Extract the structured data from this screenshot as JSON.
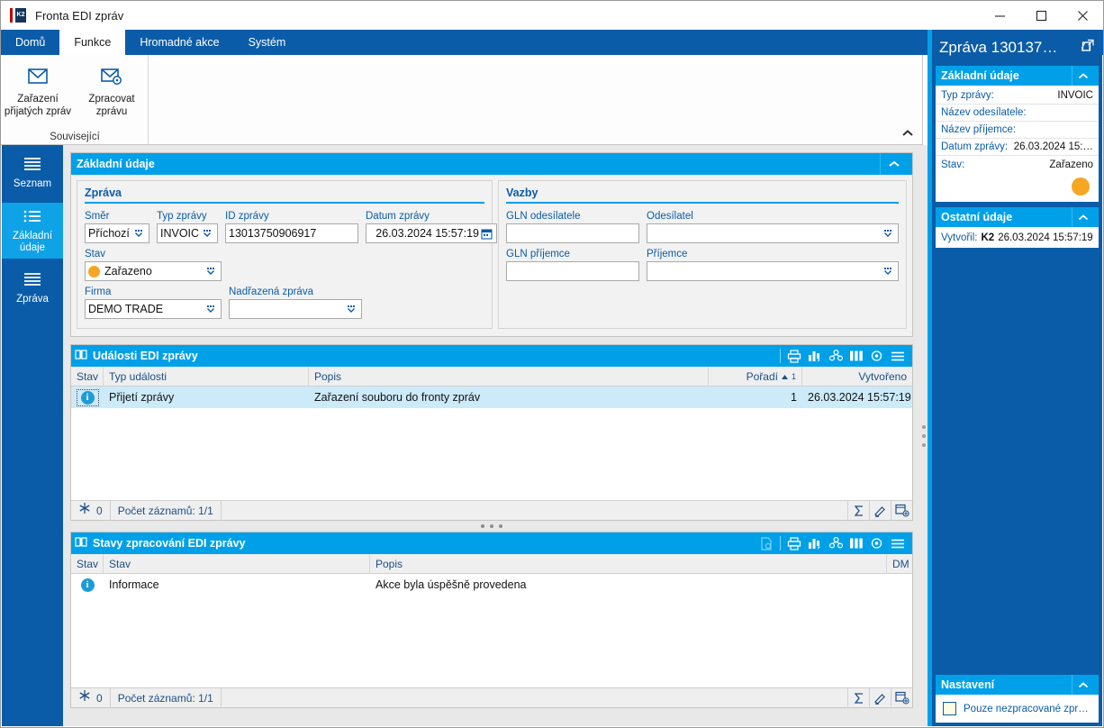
{
  "window": {
    "title": "Fronta EDI zpráv",
    "logo_text": "K2",
    "controls": {
      "minimize": "minimize-icon",
      "maximize": "maximize-icon",
      "close": "close-icon"
    }
  },
  "ribbon": {
    "tabs": [
      {
        "label": "Domů",
        "active": false
      },
      {
        "label": "Funkce",
        "active": true
      },
      {
        "label": "Hromadné akce",
        "active": false
      },
      {
        "label": "Systém",
        "active": false
      }
    ],
    "group": {
      "title": "Související",
      "buttons": [
        {
          "label_line1": "Zařazení",
          "label_line2": "přijatých zpráv",
          "icon": "mail-icon"
        },
        {
          "label_line1": "Zpracovat",
          "label_line2": "zprávu",
          "icon": "mail-settings-icon"
        }
      ]
    },
    "collapse_icon": "chevron-up-icon"
  },
  "sidebar": {
    "items": [
      {
        "label_line1": "Seznam",
        "label_line2": "",
        "icon": "list-lines-icon",
        "active": false
      },
      {
        "label_line1": "Základní",
        "label_line2": "údaje",
        "icon": "list-bullet-icon",
        "active": true
      },
      {
        "label_line1": "Zpráva",
        "label_line2": "",
        "icon": "list-lines-icon",
        "active": false
      }
    ]
  },
  "basic_panel": {
    "title": "Základní údaje",
    "message_group": {
      "title": "Zpráva",
      "fields": {
        "smer": {
          "label": "Směr",
          "value": "Příchozí"
        },
        "typ_zpravy": {
          "label": "Typ zprávy",
          "value": "INVOIC"
        },
        "id_zpravy": {
          "label": "ID zprávy",
          "value": "13013750906917"
        },
        "datum_zpravy": {
          "label": "Datum zprávy",
          "value": "26.03.2024 15:57:19"
        },
        "stav": {
          "label": "Stav",
          "value": "Zařazeno"
        },
        "firma": {
          "label": "Firma",
          "value": "DEMO TRADE"
        },
        "nadrazena_zprava": {
          "label": "Nadřazená zpráva",
          "value": ""
        }
      }
    },
    "relations_group": {
      "title": "Vazby",
      "fields": {
        "gln_odesilatele": {
          "label": "GLN odesílatele",
          "value": ""
        },
        "odesilatel": {
          "label": "Odesílatel",
          "value": ""
        },
        "gln_prijemce": {
          "label": "GLN příjemce",
          "value": ""
        },
        "prijemce": {
          "label": "Příjemce",
          "value": ""
        }
      }
    }
  },
  "events_grid": {
    "title": "Události EDI zprávy",
    "toolbar": [
      "print-icon",
      "chart-icon",
      "group-tree-icon",
      "columns-icon",
      "gear-icon",
      "menu-icon"
    ],
    "columns": [
      {
        "label": "Stav",
        "align": "left"
      },
      {
        "label": "Typ události",
        "align": "left"
      },
      {
        "label": "Popis",
        "align": "left"
      },
      {
        "label": "Pořadí",
        "align": "right",
        "sort": "asc",
        "sort_index": "1"
      },
      {
        "label": "Vytvořeno",
        "align": "right"
      }
    ],
    "rows": [
      {
        "status_icon": "info-icon",
        "typ": "Přijetí zprávy",
        "popis": "Zařazení souboru do fronty zpráv",
        "poradi": "1",
        "vytvoreno": "26.03.2024 15:57:19",
        "selected": true
      }
    ],
    "footer": {
      "filter_icon": "snowflake-icon",
      "filter_count": "0",
      "record_count": "Počet záznamů: 1/1",
      "tools": [
        "sum-icon",
        "edit-icon",
        "add-record-icon"
      ]
    }
  },
  "states_grid": {
    "title": "Stavy zpracování EDI zprávy",
    "toolbar": [
      "preview-icon",
      "print-icon",
      "chart-icon",
      "group-tree-icon",
      "columns-icon",
      "gear-icon",
      "menu-icon"
    ],
    "columns": [
      {
        "label": "Stav",
        "align": "left"
      },
      {
        "label": "Stav",
        "align": "left"
      },
      {
        "label": "Popis",
        "align": "left"
      },
      {
        "label": "DM",
        "align": "right"
      }
    ],
    "rows": [
      {
        "status_icon": "info-icon",
        "stav": "Informace",
        "popis": "Akce byla úspěšně provedena",
        "dm": "",
        "selected": false
      }
    ],
    "footer": {
      "filter_icon": "snowflake-icon",
      "filter_count": "0",
      "record_count": "Počet záznamů: 1/1",
      "tools": [
        "sum-icon",
        "edit-icon",
        "add-record-icon"
      ]
    }
  },
  "right_panel": {
    "title": "Zpráva 130137…",
    "open_icon": "external-link-icon",
    "sections": [
      {
        "title": "Základní údaje",
        "chevron": "chevron-up-icon",
        "rows": [
          {
            "key": "Typ zprávy:",
            "value": "INVOIC"
          },
          {
            "key": "Název odesílatele:",
            "value": ""
          },
          {
            "key": "Název příjemce:",
            "value": ""
          },
          {
            "key": "Datum zprávy:",
            "value": "26.03.2024 15:…"
          },
          {
            "key": "Stav:",
            "value": "Zařazeno"
          }
        ],
        "status_dot_color": "#f5a623"
      },
      {
        "title": "Ostatní údaje",
        "chevron": "chevron-up-icon",
        "created_label": "Vytvořil:",
        "created_user": "K2",
        "created_date": "26.03.2024 15:57:19"
      }
    ],
    "settings": {
      "title": "Nastavení",
      "chevron": "chevron-up-icon",
      "checkbox_label": "Pouze nezpracované zpr…",
      "checkbox_checked": false
    }
  },
  "colors": {
    "brand_blue": "#0b5ca8",
    "accent_cyan": "#00a0e9",
    "status_orange": "#f5a623",
    "selection": "#cdeaf9"
  }
}
